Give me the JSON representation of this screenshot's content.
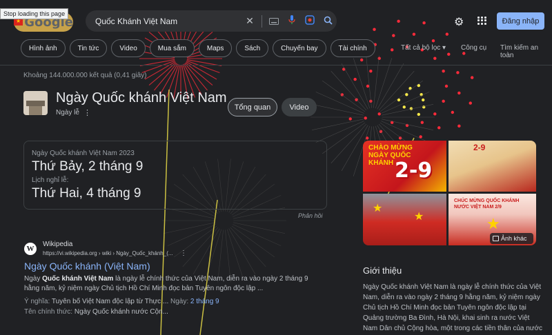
{
  "browser": {
    "tooltip": "Stop loading this page"
  },
  "header": {
    "logo_text": "Google",
    "search_query": "Quốc Khánh Việt Nam",
    "signin_label": "Đăng nhập"
  },
  "chips": [
    "Hình ảnh",
    "Tin tức",
    "Video",
    "Mua sắm",
    "Maps",
    "Sách",
    "Chuyến bay",
    "Tài chính"
  ],
  "tools": {
    "filters": "Tất cả bộ lọc",
    "tools": "Công cụ",
    "safe_search": "Tìm kiếm an toàn"
  },
  "stats": "Khoảng 144.000.000 kết quả (0,41 giây)",
  "entity": {
    "title": "Ngày Quốc khánh Việt Nam",
    "subtitle": "Ngày lễ",
    "tab_overview": "Tổng quan",
    "tab_video": "Video"
  },
  "date_card": {
    "label1": "Ngày Quốc khánh Việt Nam 2023",
    "value1": "Thứ Bảy, 2 tháng 9",
    "label2": "Lịch nghỉ lễ:",
    "value2": "Thứ Hai, 4 tháng 9",
    "feedback": "Phản hồi"
  },
  "result": {
    "favicon": "W",
    "site": "Wikipedia",
    "url": "https://vi.wikipedia.org › wiki › Ngày_Quốc_khánh_(...",
    "title": "Ngày Quốc khánh (Việt Nam)",
    "snippet_bold": "Quốc khánh Việt Nam",
    "snippet_pre": "Ngày ",
    "snippet_post": " là ngày lễ chính thức của Việt Nam, diễn ra vào ngày 2 tháng 9 hằng năm, kỷ niệm ngày Chủ tịch Hồ Chí Minh đọc bản Tuyên ngôn độc lập ...",
    "meaning_label": "Ý nghĩa:",
    "meaning_value": "Tuyên bố Việt Nam độc lập từ Thực ...",
    "day_label": "Ngày:",
    "day_value": "2 tháng 9",
    "official_label": "Tên chính thức:",
    "official_value": "Ngày Quốc khánh nước Cộn..."
  },
  "images": {
    "img1_title": "CHÀO MỪNG NGÀY QUỐC KHÁNH",
    "img1_number": "2-9",
    "img2_number": "2-9",
    "img4_title": "CHÚC MỪNG QUỐC KHÁNH NƯỚC VIỆT NAM 2/9",
    "more_label": "Ảnh khác"
  },
  "intro": {
    "heading": "Giới thiệu",
    "text": "Ngày Quốc khánh Việt Nam là ngày lễ chính thức của Việt Nam, diễn ra vào ngày 2 tháng 9 hằng năm, kỷ niệm ngày Chủ tịch Hồ Chí Minh đọc bản Tuyên ngôn độc lập tại Quảng trường Ba Đình, Hà Nội, khai sinh ra nước Việt Nam Dân chủ Cộng hòa, một trong các tiền thân của nước Cộng"
  },
  "icons": {
    "clear": "close-icon",
    "keyboard": "keyboard-icon",
    "voice": "microphone-icon",
    "lens": "lens-icon",
    "search": "search-icon",
    "settings": "gear-icon",
    "apps": "apps-grid-icon"
  },
  "colors": {
    "background": "#202124",
    "link": "#8ab4f8",
    "signin_bg": "#8ab4f8",
    "firework_red": "#ff2b3a",
    "firework_yellow": "#f6e84a"
  }
}
